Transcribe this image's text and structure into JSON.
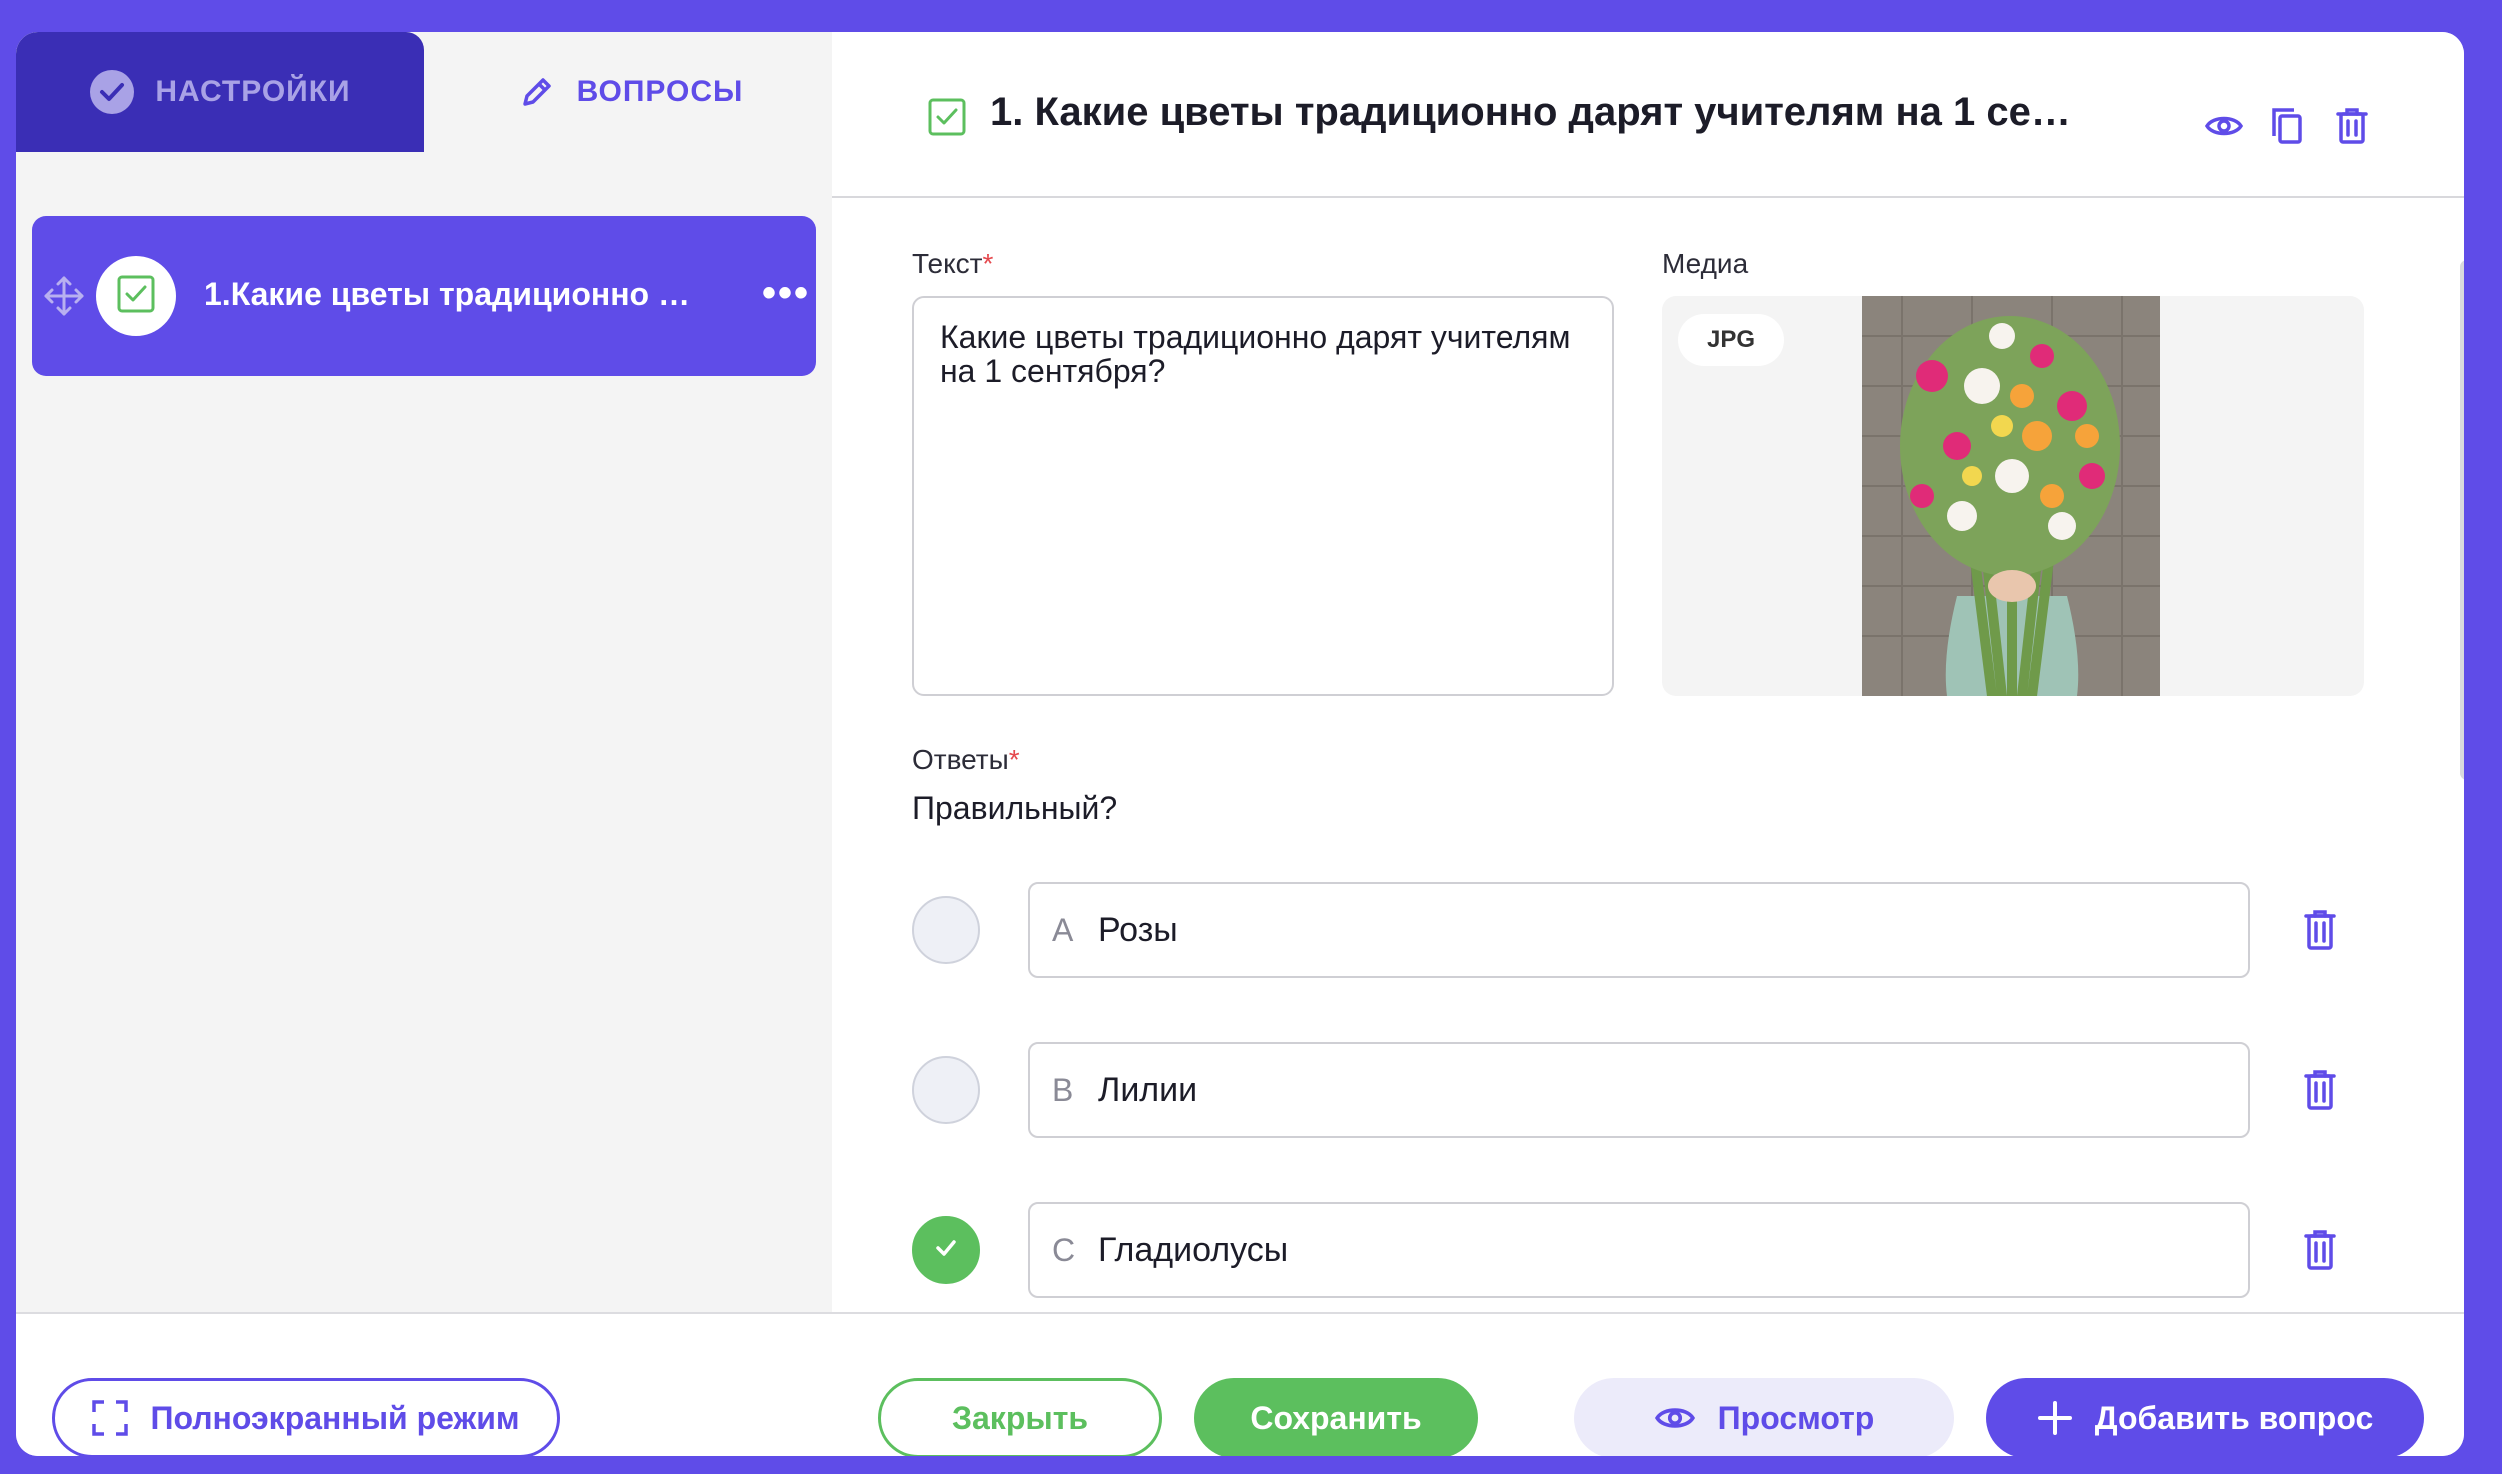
{
  "tabs": {
    "settings": "НАСТРОЙКИ",
    "questions": "ВОПРОСЫ"
  },
  "sidebar": {
    "question_item": "1.Какие цветы традиционно дарят учителям на 1 сентября?"
  },
  "header": {
    "title": "1. Какие цветы традиционно дарят учителям на 1 сентября?"
  },
  "form": {
    "text_label": "Текст",
    "required_mark": "*",
    "text_value": "Какие цветы традиционно дарят учителям на 1 сентября?",
    "media_label": "Медиа",
    "media_badge": "JPG",
    "answers_label": "Ответы",
    "correct_label": "Правильный?",
    "answers": [
      {
        "letter": "A",
        "text": "Розы",
        "correct": false
      },
      {
        "letter": "B",
        "text": "Лилии",
        "correct": false
      },
      {
        "letter": "C",
        "text": "Гладиолусы",
        "correct": true
      }
    ]
  },
  "footer": {
    "fullscreen": "Полноэкранный режим",
    "close": "Закрыть",
    "save": "Сохранить",
    "preview": "Просмотр",
    "add_question": "Добавить вопрос"
  },
  "colors": {
    "brand": "#5f4ce8",
    "success": "#5cbf5e",
    "danger": "#e5484d"
  }
}
